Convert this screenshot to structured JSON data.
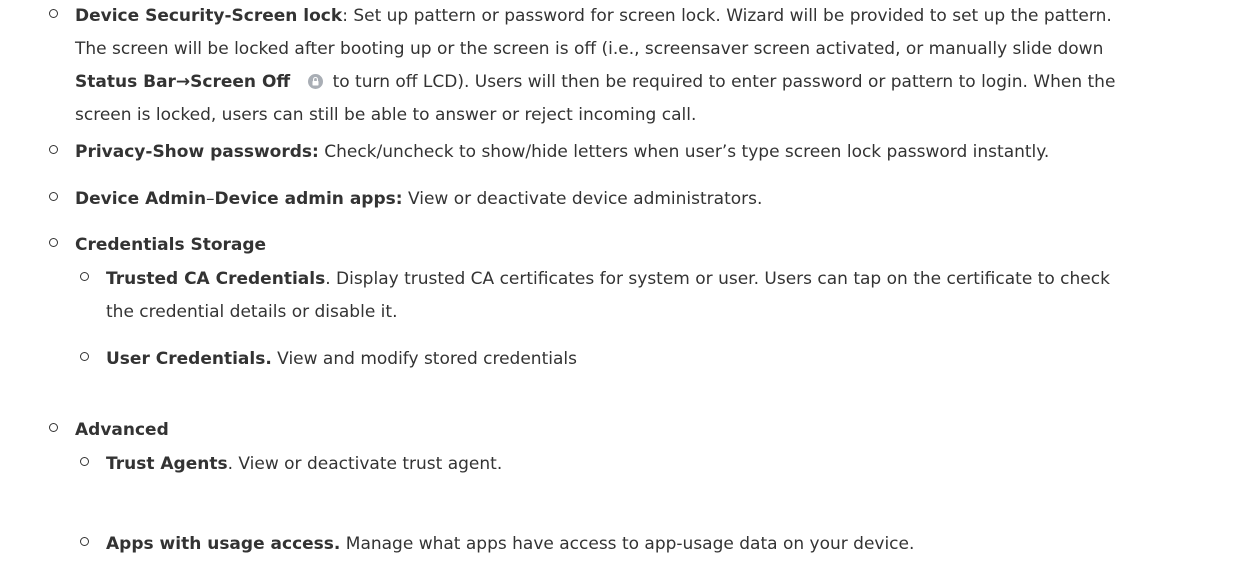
{
  "items": [
    {
      "bold": "Device Security-Screen lock",
      "text_line1": ": Set up pattern or password for screen lock. Wizard will be provided to set up the pattern.",
      "text_line2": "The screen will be locked after booting up or the screen is off (i.e., screensaver screen activated, or manually slide down",
      "bold2": "Status Bar",
      "arrow": "→",
      "bold3": "Screen Off",
      "icon": "lock-icon",
      "text_line3": " to turn off LCD). Users will then be required to enter password or pattern to login. When the",
      "text_line4": "screen is locked, users can still be able to answer or reject incoming call."
    },
    {
      "bold": "Privacy-Show passwords:",
      "text": " Check/uncheck to show/hide letters when user’s type screen lock password instantly."
    },
    {
      "bold": "Device Admin",
      "dash": "–",
      "bold2": "Device admin apps:",
      "text": " View or deactivate device administrators."
    },
    {
      "bold": "Credentials Storage",
      "children": [
        {
          "bold": "Trusted CA Credentials",
          "text_line1": ". Display trusted CA certificates for system or user. Users can tap on the certificate to check",
          "text_line2": "the credential details or disable it."
        },
        {
          "bold": "User Credentials.",
          "text": " View and modify stored credentials"
        }
      ]
    },
    {
      "bold": "Advanced",
      "children": [
        {
          "bold": "Trust Agents",
          "text": ". View or deactivate trust agent."
        },
        {
          "bold": "Apps with usage access.",
          "text": " Manage what apps have access to app-usage data on your device."
        }
      ]
    }
  ]
}
